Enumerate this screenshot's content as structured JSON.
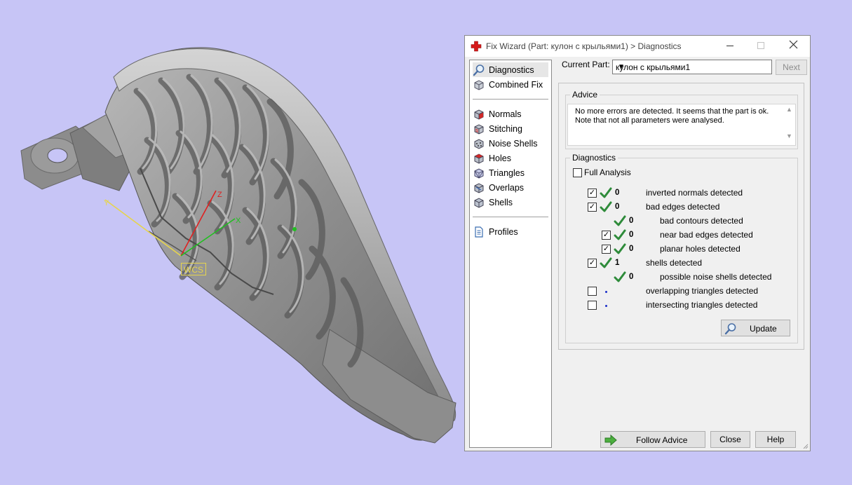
{
  "viewport": {
    "wcs_label": "WCS",
    "axis_z": "Z",
    "axis_y": "Y",
    "axis_x": "X"
  },
  "window": {
    "title": "Fix Wizard (Part: кулон с крыльями1) > Diagnostics",
    "current_part_label": "Current Part:",
    "current_part_value": "кулон с крыльями1",
    "next_label": "Next"
  },
  "nav": {
    "top": [
      {
        "label": "Diagnostics",
        "icon": "magnifier-icon"
      },
      {
        "label": "Combined Fix",
        "icon": "cube-icon"
      }
    ],
    "tools": [
      {
        "label": "Normals",
        "icon": "normals-cube-icon"
      },
      {
        "label": "Stitching",
        "icon": "stitching-cube-icon"
      },
      {
        "label": "Noise Shells",
        "icon": "noise-shells-icon"
      },
      {
        "label": "Holes",
        "icon": "holes-cube-icon"
      },
      {
        "label": "Triangles",
        "icon": "triangles-cube-icon"
      },
      {
        "label": "Overlaps",
        "icon": "overlaps-cube-icon"
      },
      {
        "label": "Shells",
        "icon": "shells-cube-icon"
      }
    ],
    "bottom": [
      {
        "label": "Profiles",
        "icon": "document-icon"
      }
    ]
  },
  "advice": {
    "title": "Advice",
    "text": "No more errors are detected. It seems that the part is ok. Note that not all parameters were analysed."
  },
  "diagnostics": {
    "title": "Diagnostics",
    "full_analysis_label": "Full Analysis",
    "full_analysis_checked": false,
    "rows": [
      {
        "checkbox": true,
        "checked": true,
        "status": "ok",
        "count": "0",
        "label": "inverted normals detected",
        "indent": 0
      },
      {
        "checkbox": true,
        "checked": true,
        "status": "ok",
        "count": "0",
        "label": "bad edges detected",
        "indent": 0
      },
      {
        "checkbox": false,
        "checked": false,
        "status": "ok",
        "count": "0",
        "label": "bad contours detected",
        "indent": 1
      },
      {
        "checkbox": true,
        "checked": true,
        "status": "ok",
        "count": "0",
        "label": "near bad edges detected",
        "indent": 1
      },
      {
        "checkbox": true,
        "checked": true,
        "status": "ok",
        "count": "0",
        "label": "planar holes detected",
        "indent": 1
      },
      {
        "checkbox": true,
        "checked": true,
        "status": "ok",
        "count": "1",
        "label": "shells detected",
        "indent": 0
      },
      {
        "checkbox": false,
        "checked": false,
        "status": "ok",
        "count": "0",
        "label": "possible noise shells detected",
        "indent": 1
      },
      {
        "checkbox": true,
        "checked": false,
        "status": "none",
        "count": "",
        "label": "overlapping triangles detected",
        "indent": 0
      },
      {
        "checkbox": true,
        "checked": false,
        "status": "none",
        "count": "",
        "label": "intersecting triangles detected",
        "indent": 0
      }
    ],
    "update_label": "Update"
  },
  "footer": {
    "follow_advice_label": "Follow Advice",
    "close_label": "Close",
    "help_label": "Help"
  },
  "colors": {
    "viewport_bg": "#c7c5f6",
    "check_green": "#2e8b3a",
    "wcs_yellow": "#e6d44d"
  }
}
